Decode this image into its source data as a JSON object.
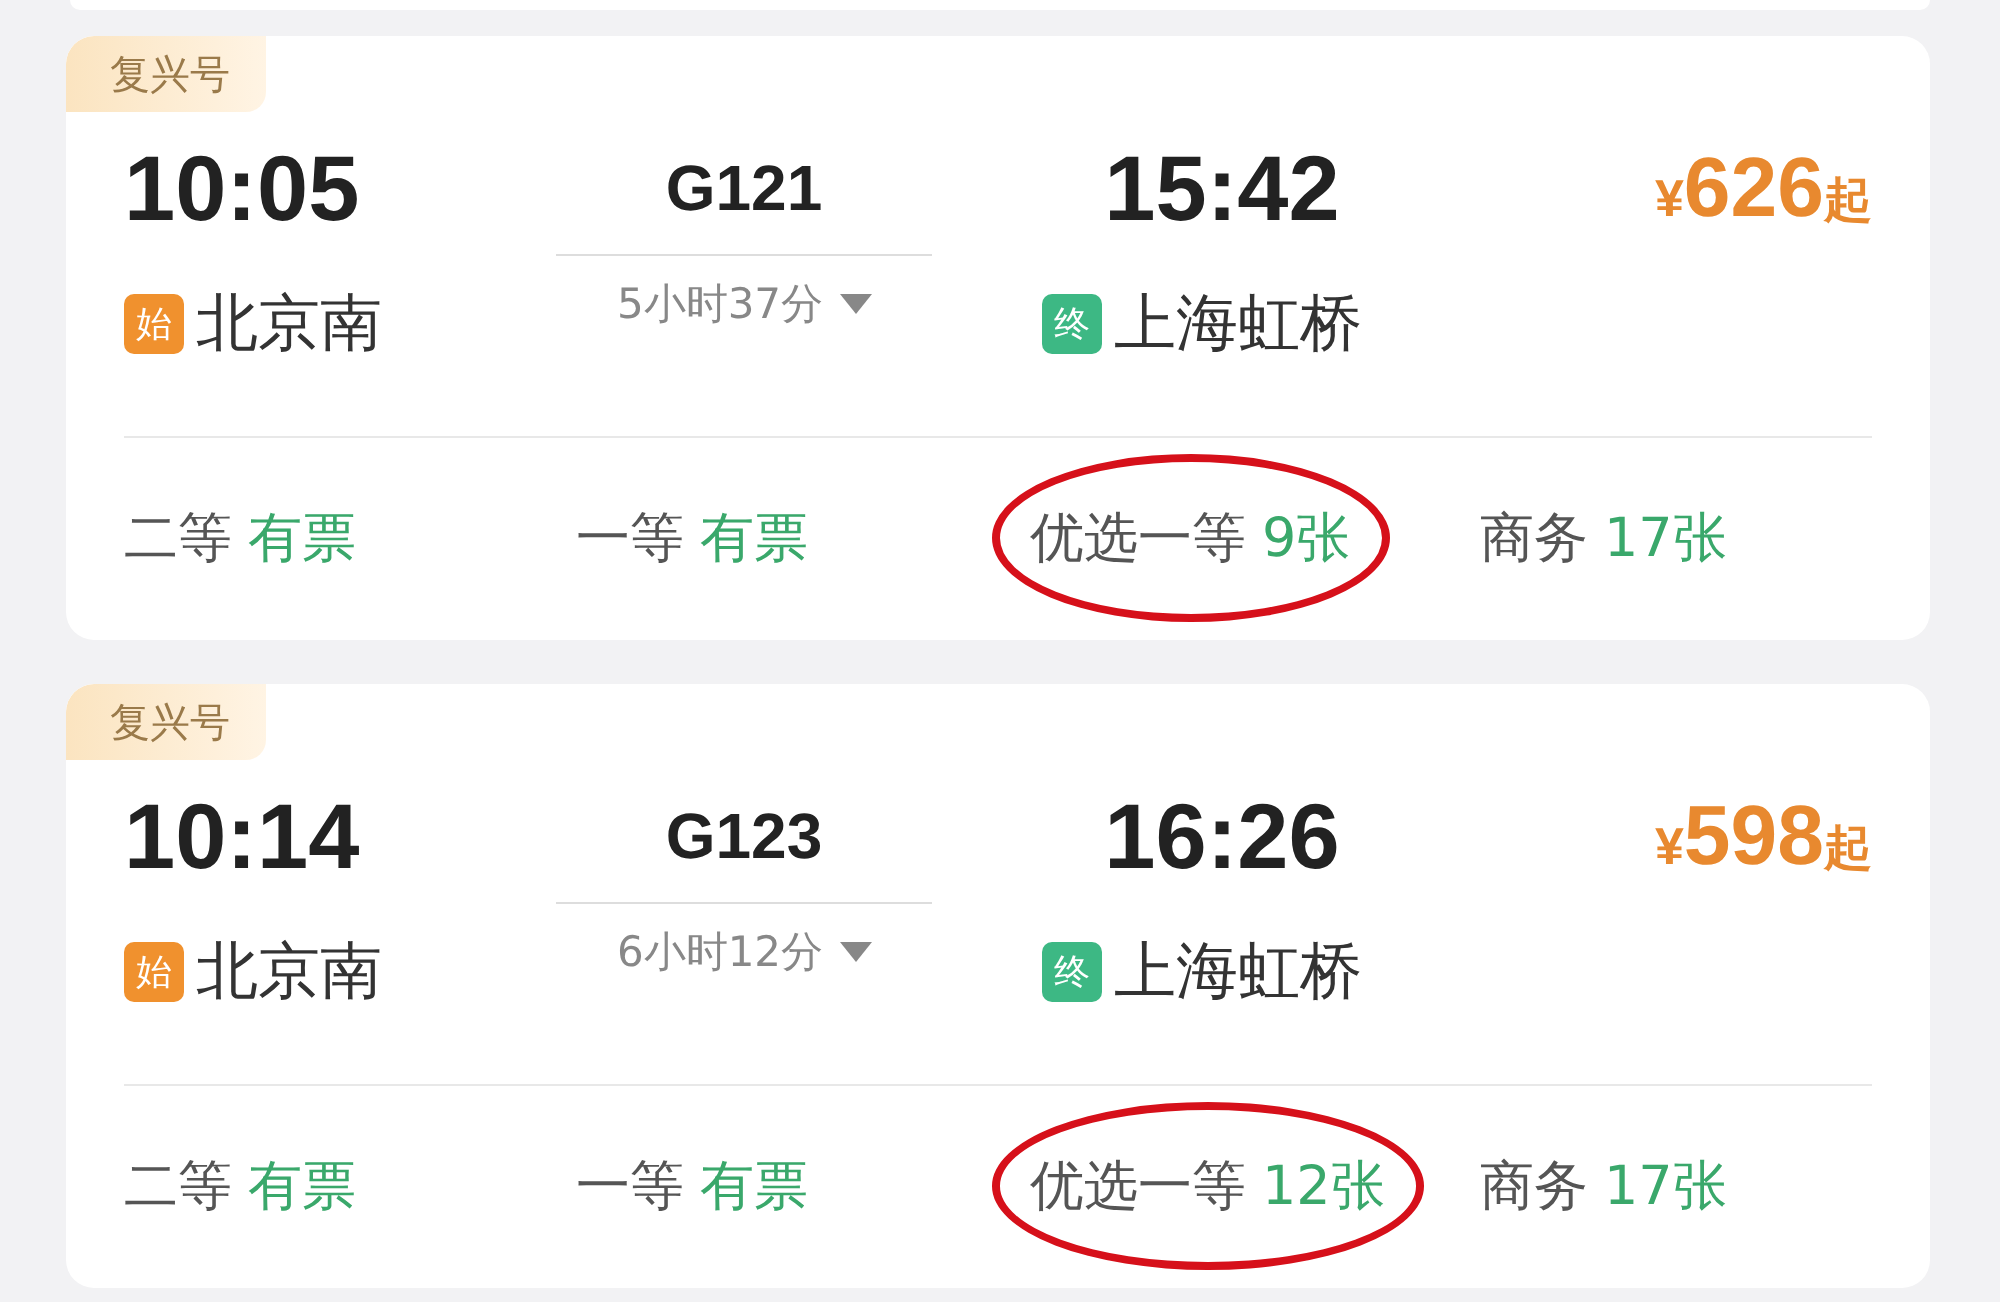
{
  "trains": [
    {
      "badge": "复兴号",
      "depart_time": "10:05",
      "train_no": "G121",
      "duration": "5小时37分",
      "arrive_time": "15:42",
      "from": {
        "kind": "origin",
        "tag": "始",
        "name": "北京南"
      },
      "to": {
        "kind": "terminal",
        "tag": "终",
        "name": "上海虹桥"
      },
      "price": {
        "currency": "¥",
        "amount": "626",
        "suffix": "起"
      },
      "seats": [
        {
          "class": "二等",
          "availability": "有票",
          "circled": false
        },
        {
          "class": "一等",
          "availability": "有票",
          "circled": false
        },
        {
          "class": "优选一等",
          "availability": "9张",
          "circled": true
        },
        {
          "class": "商务",
          "availability": "17张",
          "circled": false
        }
      ]
    },
    {
      "badge": "复兴号",
      "depart_time": "10:14",
      "train_no": "G123",
      "duration": "6小时12分",
      "arrive_time": "16:26",
      "from": {
        "kind": "origin",
        "tag": "始",
        "name": "北京南"
      },
      "to": {
        "kind": "terminal",
        "tag": "终",
        "name": "上海虹桥"
      },
      "price": {
        "currency": "¥",
        "amount": "598",
        "suffix": "起"
      },
      "seats": [
        {
          "class": "二等",
          "availability": "有票",
          "circled": false
        },
        {
          "class": "一等",
          "availability": "有票",
          "circled": false
        },
        {
          "class": "优选一等",
          "availability": "12张",
          "circled": true
        },
        {
          "class": "商务",
          "availability": "17张",
          "circled": false
        }
      ]
    }
  ]
}
